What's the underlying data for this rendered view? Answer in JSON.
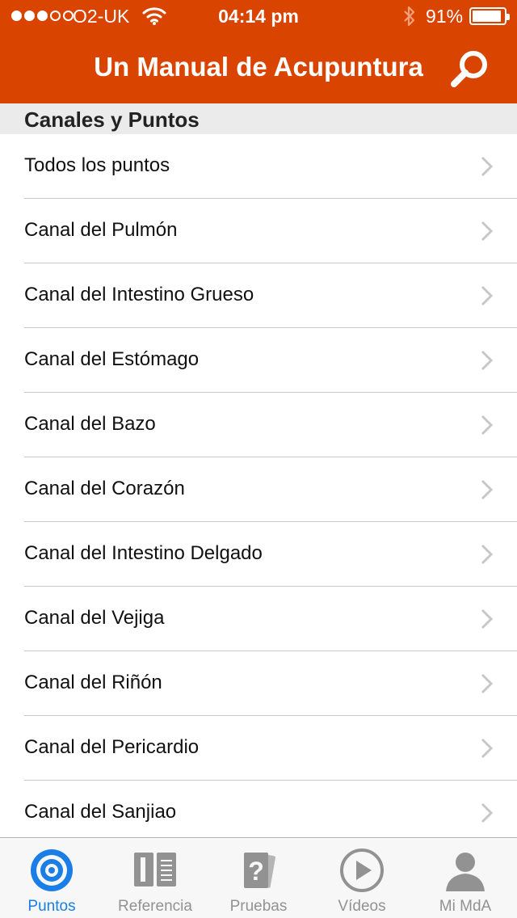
{
  "status_bar": {
    "carrier": "O2-UK",
    "time": "04:14 pm",
    "battery_percent": "91%",
    "battery_level": 0.91,
    "signal_bars_filled": 3,
    "signal_bars_total": 5
  },
  "nav": {
    "title": "Un Manual de Acupuntura",
    "search_icon": "search-icon"
  },
  "section": {
    "title": "Canales y Puntos"
  },
  "list": {
    "items": [
      {
        "label": "Todos los puntos"
      },
      {
        "label": "Canal del Pulmón"
      },
      {
        "label": "Canal del Intestino Grueso"
      },
      {
        "label": "Canal del Estómago"
      },
      {
        "label": "Canal del Bazo"
      },
      {
        "label": "Canal del Corazón"
      },
      {
        "label": "Canal del Intestino Delgado"
      },
      {
        "label": "Canal del Vejiga"
      },
      {
        "label": "Canal del Riñón"
      },
      {
        "label": "Canal del Pericardio"
      },
      {
        "label": "Canal del Sanjiao"
      }
    ]
  },
  "tabbar": {
    "tabs": [
      {
        "label": "Puntos",
        "icon": "target-icon",
        "active": true
      },
      {
        "label": "Referencia",
        "icon": "book-icon",
        "active": false
      },
      {
        "label": "Pruebas",
        "icon": "question-cards-icon",
        "active": false
      },
      {
        "label": "Vídeos",
        "icon": "play-icon",
        "active": false
      },
      {
        "label": "Mi MdA",
        "icon": "person-icon",
        "active": false
      }
    ]
  },
  "colors": {
    "accent": "#d94400",
    "active_tab": "#1a7ee6",
    "inactive_tab": "#929292",
    "section_bg": "#ebebeb"
  }
}
